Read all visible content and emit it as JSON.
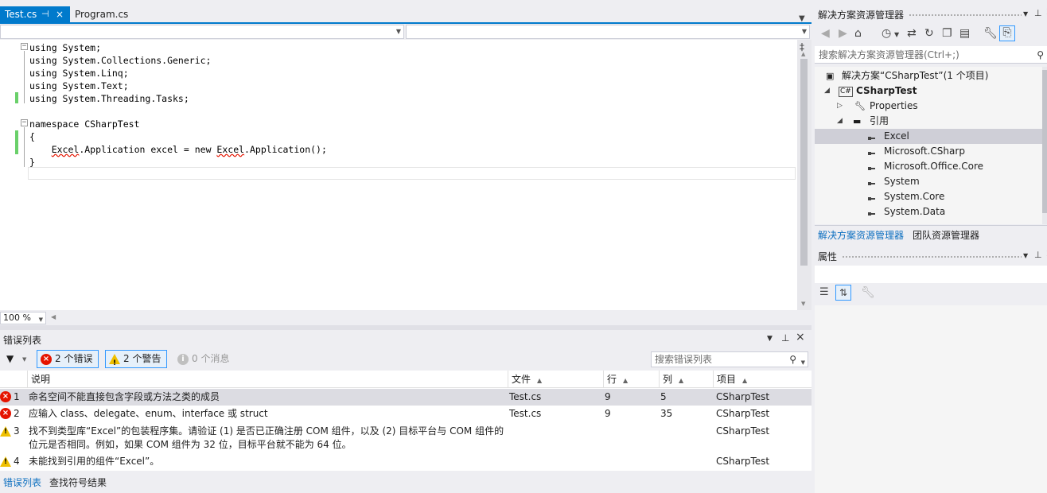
{
  "editor": {
    "tabs": [
      {
        "label": "Test.cs",
        "active": true
      },
      {
        "label": "Program.cs",
        "active": false
      }
    ],
    "code_lines": [
      "using System;",
      "using System.Collections.Generic;",
      "using System.Linq;",
      "using System.Text;",
      "using System.Threading.Tasks;",
      "",
      "namespace CSharpTest",
      "{",
      "    Excel.Application excel = new Excel.Application();",
      "}"
    ],
    "zoom": "100 %"
  },
  "error_list": {
    "title": "错误列表",
    "filters": {
      "errors": "2 个错误",
      "warnings": "2 个警告",
      "messages": "0 个消息"
    },
    "search_placeholder": "搜索错误列表",
    "columns": [
      "说明",
      "文件",
      "行",
      "列",
      "项目"
    ],
    "rows": [
      {
        "type": "error",
        "num": "1",
        "desc": "命名空间不能直接包含字段或方法之类的成员",
        "file": "Test.cs",
        "line": "9",
        "col": "5",
        "project": "CSharpTest"
      },
      {
        "type": "error",
        "num": "2",
        "desc": "应输入 class、delegate、enum、interface 或 struct",
        "file": "Test.cs",
        "line": "9",
        "col": "35",
        "project": "CSharpTest"
      },
      {
        "type": "warning",
        "num": "3",
        "desc": "找不到类型库“Excel”的包装程序集。请验证 (1) 是否已正确注册 COM 组件，以及 (2) 目标平台与 COM 组件的位元是否相同。例如，如果 COM 组件为 32 位，目标平台就不能为 64 位。",
        "file": "",
        "line": "",
        "col": "",
        "project": "CSharpTest"
      },
      {
        "type": "warning",
        "num": "4",
        "desc": "未能找到引用的组件“Excel”。",
        "file": "",
        "line": "",
        "col": "",
        "project": "CSharpTest"
      }
    ],
    "bottom_tabs": [
      "错误列表",
      "查找符号结果"
    ]
  },
  "solution_explorer": {
    "title": "解决方案资源管理器",
    "search_placeholder": "搜索解决方案资源管理器(Ctrl+;)",
    "tree": {
      "solution": "解决方案“CSharpTest”(1 个项目)",
      "project": "CSharpTest",
      "properties": "Properties",
      "references": "引用",
      "ref_items": [
        "Excel",
        "Microsoft.CSharp",
        "Microsoft.Office.Core",
        "System",
        "System.Core",
        "System.Data"
      ]
    },
    "tabs": [
      "解决方案资源管理器",
      "团队资源管理器"
    ]
  },
  "properties": {
    "title": "属性"
  },
  "colors": {
    "accent": "#007acc",
    "error": "#e51400",
    "warning": "#f0c000",
    "change_margin": "#6ad06a"
  }
}
